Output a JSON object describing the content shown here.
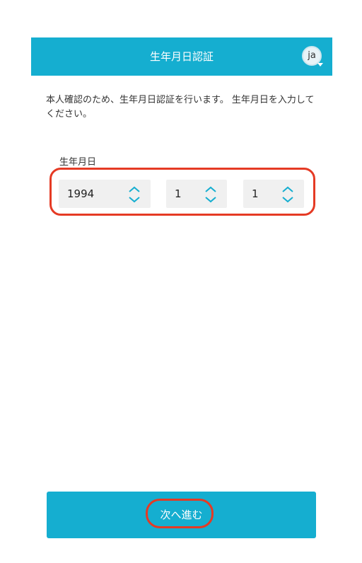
{
  "header": {
    "title": "生年月日認証",
    "language": "ja"
  },
  "intro_text": "本人確認のため、生年月日認証を行います。 生年月日を入力してください。",
  "dob": {
    "label": "生年月日",
    "year": "1994",
    "month": "1",
    "day": "1"
  },
  "next_button": {
    "label": "次へ進む"
  },
  "colors": {
    "accent": "#15aed0",
    "highlight": "#e53a24"
  },
  "icons": {
    "spinner": "chevron-up-down-icon",
    "language": "language-badge"
  }
}
